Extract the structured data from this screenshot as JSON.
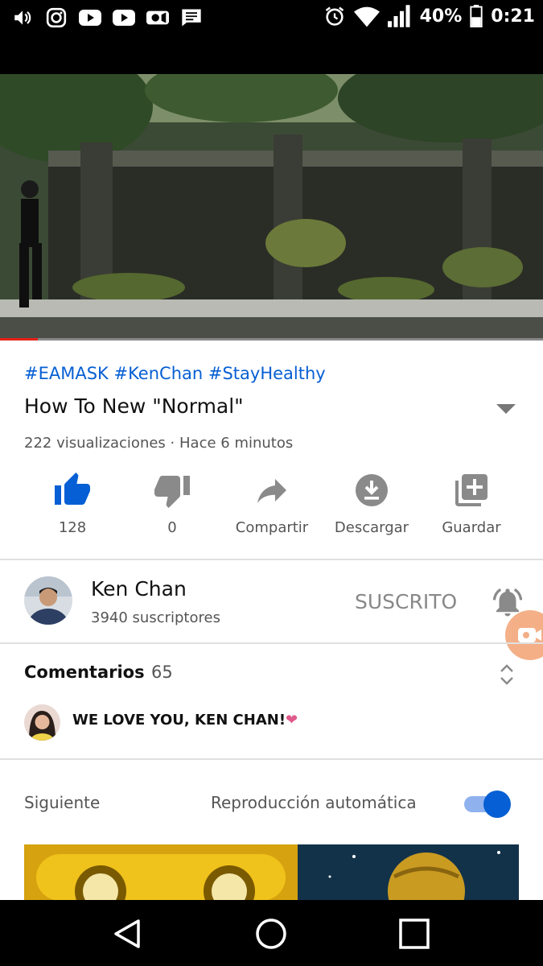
{
  "status_bar": {
    "battery": "40%",
    "time": "0:21",
    "left_icons": [
      "volume-icon",
      "instagram-icon",
      "youtube-icon",
      "youtube-icon",
      "video-camera-icon",
      "message-icon"
    ],
    "right_icons": [
      "alarm-icon",
      "wifi-icon",
      "signal-icon",
      "battery-icon"
    ]
  },
  "player": {
    "progress": 0.07,
    "progress_color": "#e62117"
  },
  "video": {
    "hashtags": "#EAMASK #KenChan #StayHealthy",
    "title": "How To New \"Normal\"",
    "views": "222 visualizaciones",
    "separator": "·",
    "uploaded": "Hace 6 minutos"
  },
  "actions": [
    {
      "icon": "thumbs-up-icon",
      "label": "128",
      "active": true
    },
    {
      "icon": "thumbs-down-icon",
      "label": "0",
      "active": false
    },
    {
      "icon": "share-icon",
      "label": "Compartir",
      "active": false
    },
    {
      "icon": "download-icon",
      "label": "Descargar",
      "active": false
    },
    {
      "icon": "save-playlist-icon",
      "label": "Guardar",
      "active": false
    }
  ],
  "channel": {
    "name": "Ken Chan",
    "subscribers": "3940 suscriptores",
    "subscribe_state": "SUSCRITO"
  },
  "comments": {
    "label": "Comentarios",
    "count": "65",
    "top_comment": "WE LOVE YOU, KEN CHAN!",
    "emoji": "❤"
  },
  "up_next": {
    "label": "Siguiente",
    "autoplay_label": "Reproducción automática",
    "autoplay_on": true
  },
  "colors": {
    "accent_blue": "#065fd4",
    "progress_red": "#e62117",
    "heart_pink": "#e05a8c"
  }
}
